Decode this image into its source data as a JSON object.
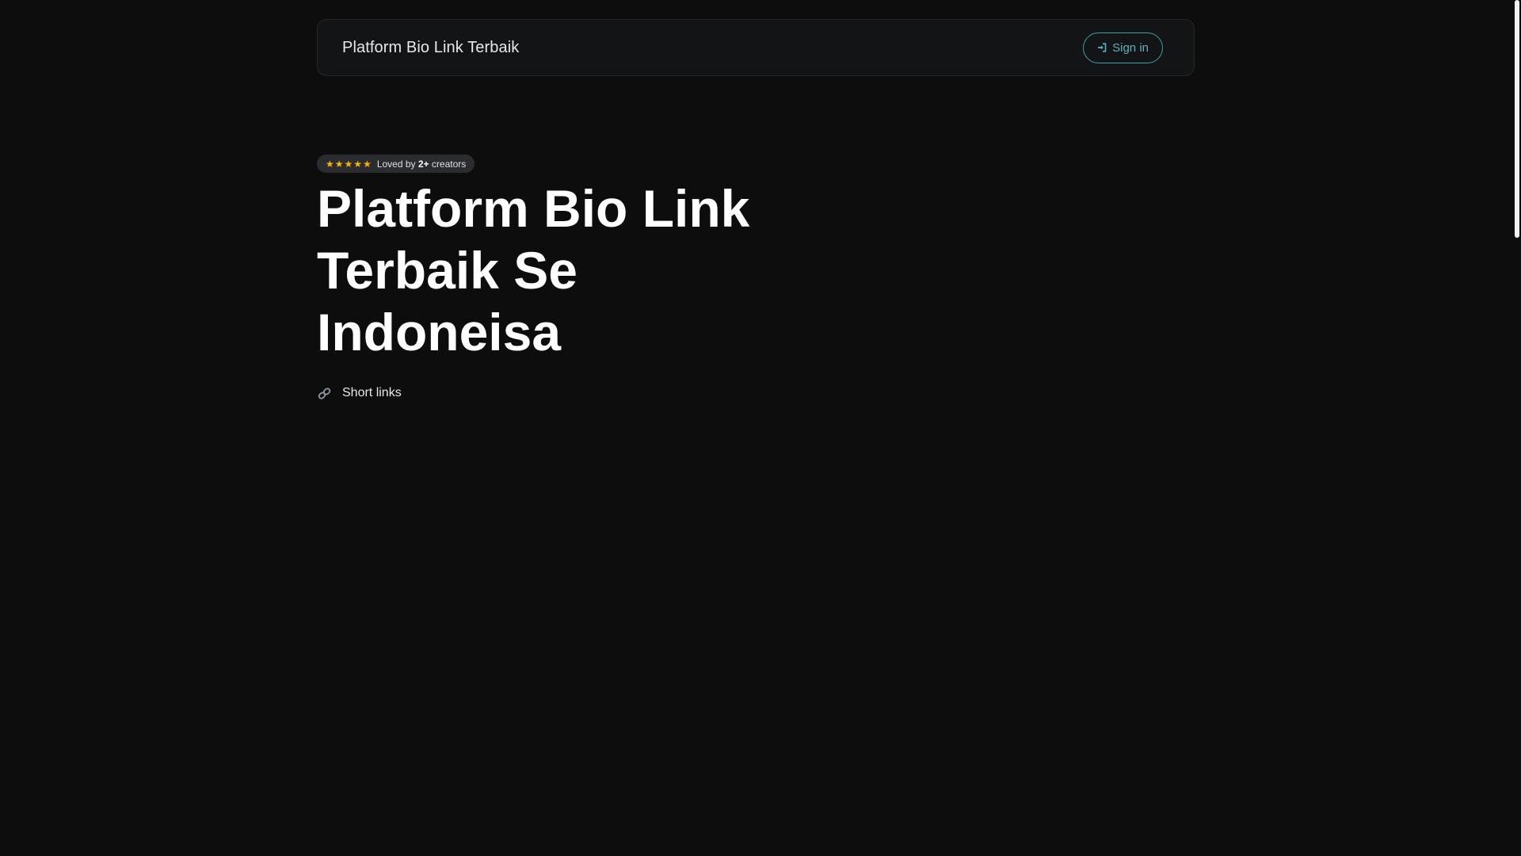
{
  "navbar": {
    "brand": "Platform Bio Link Terbaik",
    "signin_label": "Sign in",
    "signin_icon": "sign-in-icon",
    "accent_color": "#3e9ea7"
  },
  "badge": {
    "stars": 5,
    "star_color": "#f5b400",
    "prefix": "Loved by",
    "count": "2+",
    "suffix": "creators"
  },
  "hero": {
    "title": "Platform Bio Link Terbaik Se Indoneisa"
  },
  "features": [
    {
      "icon": "link-icon",
      "label": "Short links"
    }
  ]
}
